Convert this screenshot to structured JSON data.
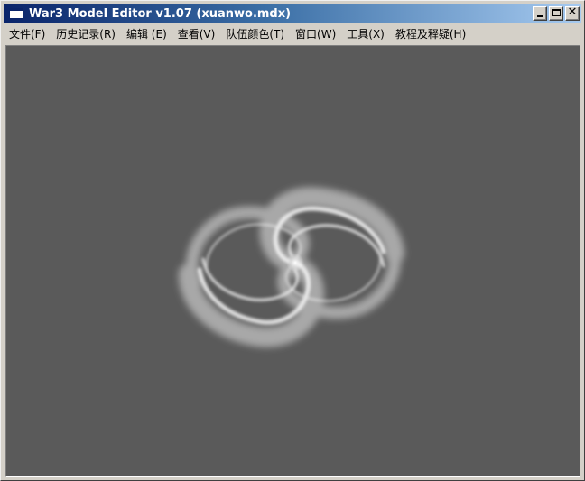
{
  "window": {
    "title": "War3 Model Editor v1.07 (xuanwo.mdx)"
  },
  "title_buttons": {
    "minimize_icon": "minimize-icon",
    "maximize_icon": "maximize-icon",
    "close_glyph": "✕"
  },
  "menu": {
    "items": [
      {
        "label": "文件(F)"
      },
      {
        "label": "历史记录(R)"
      },
      {
        "label": "编辑 (E)"
      },
      {
        "label": "查看(V)"
      },
      {
        "label": "队伍颜色(T)"
      },
      {
        "label": "窗口(W)"
      },
      {
        "label": "工具(X)"
      },
      {
        "label": "教程及释疑(H)"
      }
    ]
  },
  "viewport": {
    "background": "#5a5a5a",
    "model_icon": "swirl-vortex-model"
  }
}
